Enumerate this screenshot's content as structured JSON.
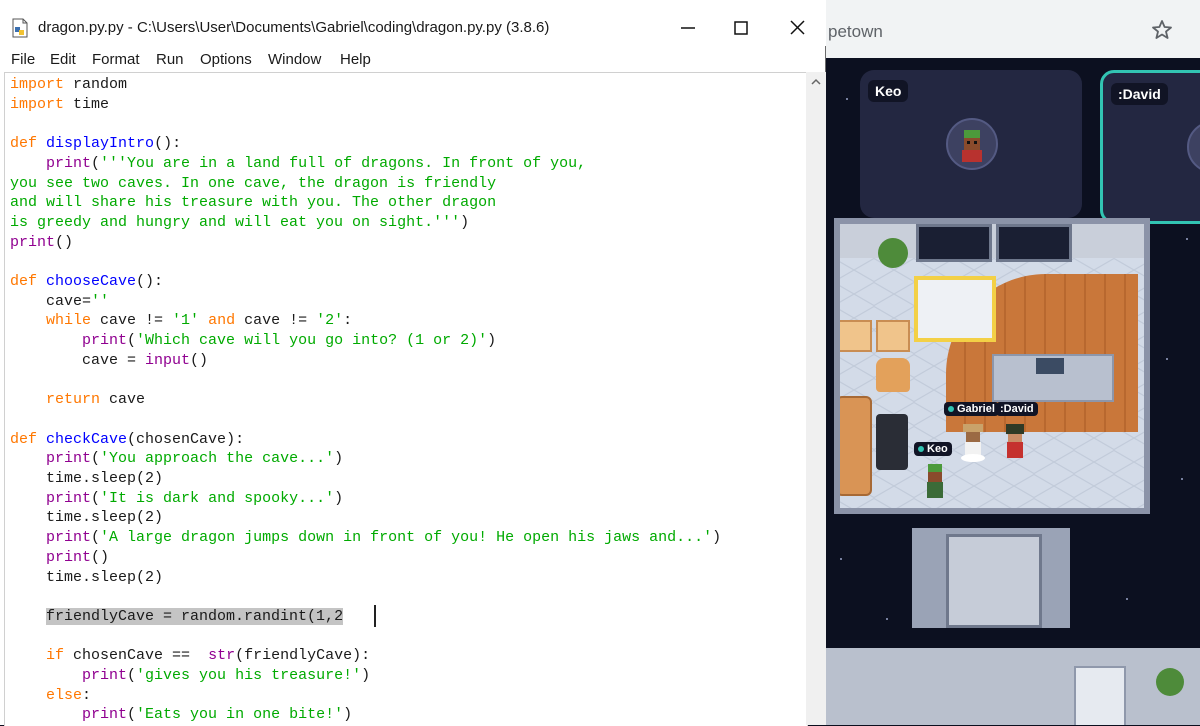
{
  "browser": {
    "url_fragment": "petown",
    "star_icon": "bookmark-star-icon"
  },
  "game": {
    "tiles": [
      {
        "name": "Keo"
      },
      {
        "name": ":David"
      }
    ],
    "players": [
      {
        "name": "Gabriel"
      },
      {
        "name": ":David"
      },
      {
        "name": "Keo"
      }
    ],
    "accent_color": "#32c4b2"
  },
  "idle": {
    "title": "dragon.py.py - C:\\Users\\User\\Documents\\Gabriel\\coding\\dragon.py.py (3.8.6)",
    "menu": [
      "File",
      "Edit",
      "Format",
      "Run",
      "Options",
      "Window",
      "Help"
    ],
    "colors": {
      "keyword": "#ff7700",
      "string": "#00aa00",
      "definition": "#0000ff",
      "builtin": "#900090"
    },
    "code": [
      [
        {
          "t": "import",
          "c": "kw"
        },
        {
          "t": " random",
          "c": ""
        }
      ],
      [
        {
          "t": "import",
          "c": "kw"
        },
        {
          "t": " time",
          "c": ""
        }
      ],
      [],
      [
        {
          "t": "def",
          "c": "kw"
        },
        {
          "t": " ",
          "c": ""
        },
        {
          "t": "displayIntro",
          "c": "def"
        },
        {
          "t": "():",
          "c": ""
        }
      ],
      [
        {
          "t": "    ",
          "c": ""
        },
        {
          "t": "print",
          "c": "bi"
        },
        {
          "t": "(",
          "c": ""
        },
        {
          "t": "'''You are in a land full of dragons. In front of you,",
          "c": "str"
        }
      ],
      [
        {
          "t": "you see two caves. In one cave, the dragon is friendly",
          "c": "str"
        }
      ],
      [
        {
          "t": "and will share his treasure with you. The other dragon",
          "c": "str"
        }
      ],
      [
        {
          "t": "is greedy and hungry and will eat you on sight.'''",
          "c": "str"
        },
        {
          "t": ")",
          "c": ""
        }
      ],
      [
        {
          "t": "print",
          "c": "bi"
        },
        {
          "t": "()",
          "c": ""
        }
      ],
      [],
      [
        {
          "t": "def",
          "c": "kw"
        },
        {
          "t": " ",
          "c": ""
        },
        {
          "t": "chooseCave",
          "c": "def"
        },
        {
          "t": "():",
          "c": ""
        }
      ],
      [
        {
          "t": "    cave=",
          "c": ""
        },
        {
          "t": "''",
          "c": "str"
        }
      ],
      [
        {
          "t": "    ",
          "c": ""
        },
        {
          "t": "while",
          "c": "kw"
        },
        {
          "t": " cave != ",
          "c": ""
        },
        {
          "t": "'1'",
          "c": "str"
        },
        {
          "t": " ",
          "c": ""
        },
        {
          "t": "and",
          "c": "kw"
        },
        {
          "t": " cave != ",
          "c": ""
        },
        {
          "t": "'2'",
          "c": "str"
        },
        {
          "t": ":",
          "c": ""
        }
      ],
      [
        {
          "t": "        ",
          "c": ""
        },
        {
          "t": "print",
          "c": "bi"
        },
        {
          "t": "(",
          "c": ""
        },
        {
          "t": "'Which cave will you go into? (1 or 2)'",
          "c": "str"
        },
        {
          "t": ")",
          "c": ""
        }
      ],
      [
        {
          "t": "        cave = ",
          "c": ""
        },
        {
          "t": "input",
          "c": "bi"
        },
        {
          "t": "()",
          "c": ""
        }
      ],
      [],
      [
        {
          "t": "    ",
          "c": ""
        },
        {
          "t": "return",
          "c": "kw"
        },
        {
          "t": " cave",
          "c": ""
        }
      ],
      [],
      [
        {
          "t": "def",
          "c": "kw"
        },
        {
          "t": " ",
          "c": ""
        },
        {
          "t": "checkCave",
          "c": "def"
        },
        {
          "t": "(chosenCave):",
          "c": ""
        }
      ],
      [
        {
          "t": "    ",
          "c": ""
        },
        {
          "t": "print",
          "c": "bi"
        },
        {
          "t": "(",
          "c": ""
        },
        {
          "t": "'You approach the cave...'",
          "c": "str"
        },
        {
          "t": ")",
          "c": ""
        }
      ],
      [
        {
          "t": "    time.sleep(2)",
          "c": ""
        }
      ],
      [
        {
          "t": "    ",
          "c": ""
        },
        {
          "t": "print",
          "c": "bi"
        },
        {
          "t": "(",
          "c": ""
        },
        {
          "t": "'It is dark and spooky...'",
          "c": "str"
        },
        {
          "t": ")",
          "c": ""
        }
      ],
      [
        {
          "t": "    time.sleep(2)",
          "c": ""
        }
      ],
      [
        {
          "t": "    ",
          "c": ""
        },
        {
          "t": "print",
          "c": "bi"
        },
        {
          "t": "(",
          "c": ""
        },
        {
          "t": "'A large dragon jumps down in front of you! He open his jaws and...'",
          "c": "str"
        },
        {
          "t": ")",
          "c": ""
        }
      ],
      [
        {
          "t": "    ",
          "c": ""
        },
        {
          "t": "print",
          "c": "bi"
        },
        {
          "t": "()",
          "c": ""
        }
      ],
      [
        {
          "t": "    time.sleep(2)",
          "c": ""
        }
      ],
      [],
      [
        {
          "t": "    ",
          "c": ""
        },
        {
          "t": "friendlyCave = random.randint(1,2",
          "c": "sel"
        }
      ],
      [],
      [
        {
          "t": "    ",
          "c": ""
        },
        {
          "t": "if",
          "c": "kw"
        },
        {
          "t": " chosenCave ==  ",
          "c": ""
        },
        {
          "t": "str",
          "c": "bi"
        },
        {
          "t": "(friendlyCave):",
          "c": ""
        }
      ],
      [
        {
          "t": "        ",
          "c": ""
        },
        {
          "t": "print",
          "c": "bi"
        },
        {
          "t": "(",
          "c": ""
        },
        {
          "t": "'gives you his treasure!'",
          "c": "str"
        },
        {
          "t": ")",
          "c": ""
        }
      ],
      [
        {
          "t": "    ",
          "c": ""
        },
        {
          "t": "else",
          "c": "kw"
        },
        {
          "t": ":",
          "c": ""
        }
      ],
      [
        {
          "t": "        ",
          "c": ""
        },
        {
          "t": "print",
          "c": "bi"
        },
        {
          "t": "(",
          "c": ""
        },
        {
          "t": "'Eats you in one bite!'",
          "c": "str"
        },
        {
          "t": ")",
          "c": ""
        }
      ]
    ]
  }
}
